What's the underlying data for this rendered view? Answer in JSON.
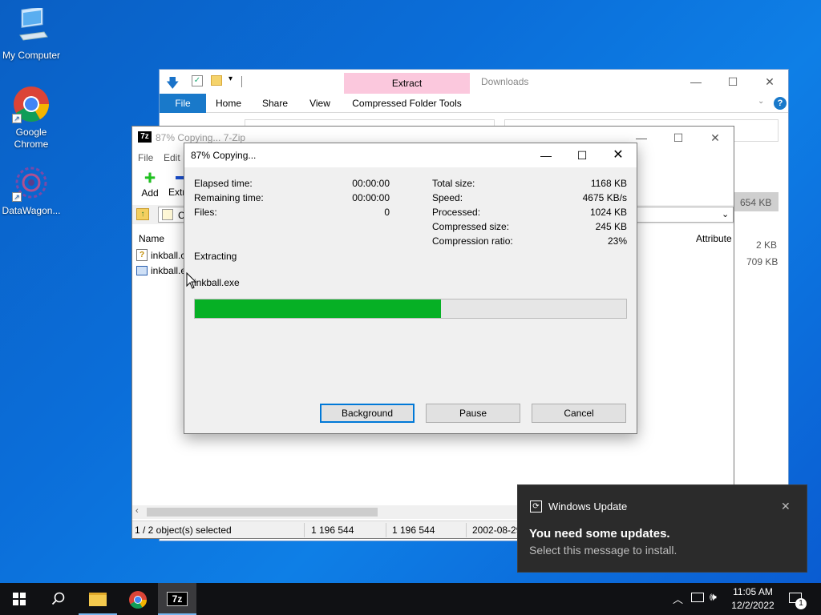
{
  "desktop": {
    "icons": [
      {
        "label": "My Computer"
      },
      {
        "label": "Google Chrome"
      },
      {
        "label": "DataWagon..."
      }
    ]
  },
  "explorer": {
    "title": "Downloads",
    "context_tab": "Extract",
    "tabs": [
      "File",
      "Home",
      "Share",
      "View",
      "Compressed Folder Tools"
    ],
    "sizes": [
      "654 KB",
      "2 KB",
      "709 KB"
    ]
  },
  "zip": {
    "title": "87% Copying... 7-Zip",
    "title_icon": "7z",
    "menu": [
      "File",
      "Edit"
    ],
    "toolbar": {
      "add": "Add",
      "extract": "Extr"
    },
    "address_text": "C",
    "columns": {
      "name": "Name",
      "attributes": "Attribute"
    },
    "files": [
      "inkball.c",
      "inkball.e"
    ],
    "status": {
      "selected": "1 / 2 object(s) selected",
      "size1": "1 196 544",
      "size2": "1 196 544",
      "date": "2002-08-29"
    }
  },
  "dialog": {
    "title": "87% Copying...",
    "left_stats": [
      {
        "label": "Elapsed time:",
        "value": "00:00:00"
      },
      {
        "label": "Remaining time:",
        "value": "00:00:00"
      },
      {
        "label": "Files:",
        "value": "0"
      }
    ],
    "right_stats": [
      {
        "label": "Total size:",
        "value": "1168 KB"
      },
      {
        "label": "Speed:",
        "value": "4675 KB/s"
      },
      {
        "label": "Processed:",
        "value": "1024 KB"
      },
      {
        "label": "Compressed size:",
        "value": "245 KB"
      },
      {
        "label": "Compression ratio:",
        "value": "23%"
      }
    ],
    "operation": "Extracting",
    "current_file": "inkball.exe",
    "progress": 0.57,
    "buttons": {
      "background": "Background",
      "pause": "Pause",
      "cancel": "Cancel"
    }
  },
  "toast": {
    "app": "Windows Update",
    "heading": "You need some updates.",
    "body": "Select this message to install."
  },
  "taskbar": {
    "time": "11:05 AM",
    "date": "12/2/2022",
    "notification_count": "1"
  },
  "colors": {
    "progress_fill": "#06b025",
    "accent": "#0078d7",
    "ribbon_file": "#1979ca",
    "extract_tab": "#fbc8dd"
  }
}
